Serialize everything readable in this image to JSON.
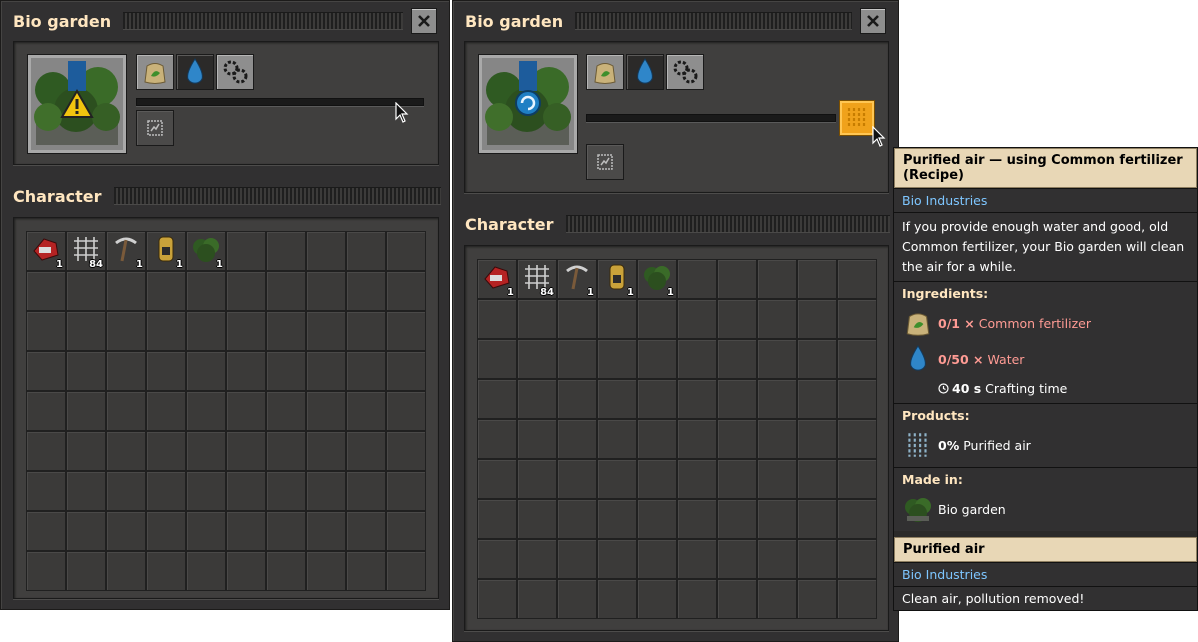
{
  "window_left": {
    "title": "Bio garden",
    "character_title": "Character",
    "inventory": [
      {
        "icon": "armor-icon",
        "count": "1"
      },
      {
        "icon": "grid-item-icon",
        "count": "84"
      },
      {
        "icon": "pickaxe-icon",
        "count": "1"
      },
      {
        "icon": "suit-icon",
        "count": "1"
      },
      {
        "icon": "bio-garden-icon",
        "count": "1"
      }
    ]
  },
  "window_right": {
    "title": "Bio garden",
    "character_title": "Character",
    "inventory": [
      {
        "icon": "armor-icon",
        "count": "1"
      },
      {
        "icon": "grid-item-icon",
        "count": "84"
      },
      {
        "icon": "pickaxe-icon",
        "count": "1"
      },
      {
        "icon": "suit-icon",
        "count": "1"
      },
      {
        "icon": "bio-garden-icon",
        "count": "1"
      }
    ]
  },
  "tooltip": {
    "recipe_title": "Purified air — using Common fertilizer (Recipe)",
    "mod": "Bio Industries",
    "description": "If you provide enough water and good, old Common fertilizer, your Bio garden will clean the air for a while.",
    "ingredients_label": "Ingredients:",
    "ingredients": [
      {
        "icon": "fertilizer-icon",
        "amount": "0/1 ×",
        "name": "Common fertilizer"
      },
      {
        "icon": "water-drop-icon",
        "amount": "0/50 ×",
        "name": "Water"
      }
    ],
    "crafting_time_value": "40 s",
    "crafting_time_label": "Crafting time",
    "products_label": "Products:",
    "product_amount": "0%",
    "product_name": "Purified air",
    "made_in_label": "Made in:",
    "made_in_name": "Bio garden",
    "item_title": "Purified air",
    "item_mod": "Bio Industries",
    "item_description": "Clean air, pollution removed!"
  },
  "colors": {
    "title_text": "#ffe6c0",
    "mod_text": "#7ec6ff",
    "missing_text": "#ff9b94",
    "recipe_button": "#f0a21b"
  }
}
